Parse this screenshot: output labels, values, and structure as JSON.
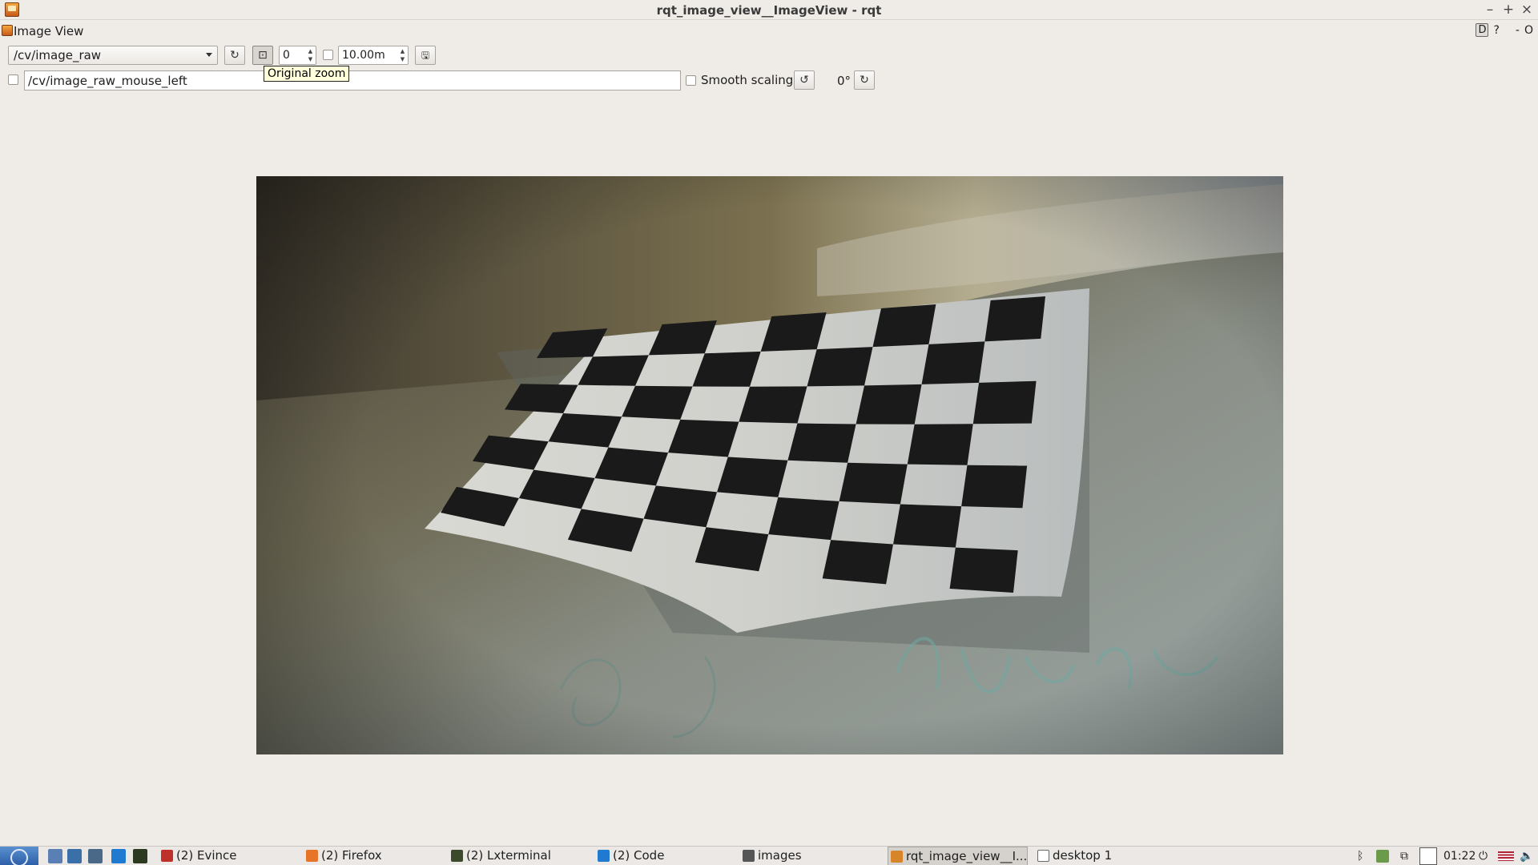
{
  "window": {
    "title": "rqt_image_view__ImageView - rqt",
    "controls": [
      "–",
      "+",
      "×"
    ]
  },
  "dock": {
    "title": "Image View",
    "buttons": [
      "D",
      "?",
      "-",
      "O"
    ]
  },
  "toolbar": {
    "topic": "/cv/image_raw",
    "refresh_glyph": "↻",
    "zoom_glyph": "⊡",
    "spin_value": "0",
    "timeout_value": "10.00m",
    "save_glyph": "🖫",
    "tooltip": "Original zoom"
  },
  "row2": {
    "publish_topic": "/cv/image_raw_mouse_left",
    "smooth_label": "Smooth scaling",
    "rotate_left_glyph": "↺",
    "rotation": "0°",
    "rotate_right_glyph": "↻"
  },
  "taskbar": {
    "tasks": [
      {
        "label": "(2) Evince",
        "color": "#c0302a"
      },
      {
        "label": "(2) Firefox",
        "color": "#e8742a"
      },
      {
        "label": "(2) Lxterminal",
        "color": "#3a4a2a"
      },
      {
        "label": "(2) Code",
        "color": "#1f7ad0"
      },
      {
        "label": "images",
        "color": "#555555"
      },
      {
        "label": "rqt_image_view__I...",
        "color": "#d6852a"
      },
      {
        "label": "desktop 1",
        "color": "#6a6a6a"
      }
    ],
    "clock": "01:22"
  },
  "colors": {
    "background": "#efebe7",
    "tooltip_bg": "#ffffdc",
    "taskbar_start": "#2b5ea6"
  }
}
